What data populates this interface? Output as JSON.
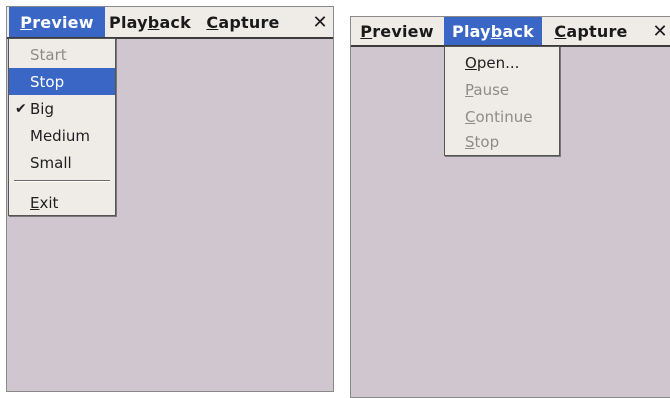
{
  "left_window": {
    "menubar": [
      {
        "id": "preview",
        "pre": "",
        "u": "P",
        "post": "review",
        "active": true,
        "bold": true
      },
      {
        "id": "playback",
        "pre": "Play",
        "u": "b",
        "post": "ack",
        "active": false,
        "bold": true
      },
      {
        "id": "capture",
        "pre": "",
        "u": "C",
        "post": "apture",
        "active": false,
        "bold": true
      }
    ],
    "close_label": "✕",
    "dropdown": {
      "items": [
        {
          "id": "start",
          "pre": "Start",
          "u": "",
          "post": "",
          "state": "disabled"
        },
        {
          "id": "stop",
          "pre": "Stop",
          "u": "",
          "post": "",
          "state": "selected"
        },
        {
          "id": "big",
          "pre": "Big",
          "u": "",
          "post": "",
          "state": "normal",
          "checked": true
        },
        {
          "id": "medium",
          "pre": "Medium",
          "u": "",
          "post": "",
          "state": "normal"
        },
        {
          "id": "small",
          "pre": "Small",
          "u": "",
          "post": "",
          "state": "normal"
        },
        {
          "id": "exit",
          "pre": "",
          "u": "E",
          "post": "xit",
          "state": "normal"
        }
      ],
      "check_mark": "✔"
    }
  },
  "right_window": {
    "menubar": [
      {
        "id": "preview",
        "pre": "",
        "u": "P",
        "post": "review",
        "active": false,
        "bold": true
      },
      {
        "id": "playback",
        "pre": "Play",
        "u": "b",
        "post": "ack",
        "active": true,
        "bold": true
      },
      {
        "id": "capture",
        "pre": "",
        "u": "C",
        "post": "apture",
        "active": false,
        "bold": true
      }
    ],
    "close_label": "✕",
    "dropdown": {
      "items": [
        {
          "id": "open",
          "pre": "",
          "u": "O",
          "post": "pen...",
          "state": "normal"
        },
        {
          "id": "pause",
          "pre": "",
          "u": "P",
          "post": "ause",
          "state": "disabled"
        },
        {
          "id": "continue",
          "pre": "",
          "u": "C",
          "post": "ontinue",
          "state": "disabled"
        },
        {
          "id": "stop",
          "pre": "",
          "u": "S",
          "post": "top",
          "state": "disabled"
        }
      ]
    }
  },
  "colors": {
    "accent": "#3a67c5",
    "menu_bg": "#efece8",
    "client_bg": "#cfc6cf",
    "disabled_text": "#8f8c88"
  }
}
